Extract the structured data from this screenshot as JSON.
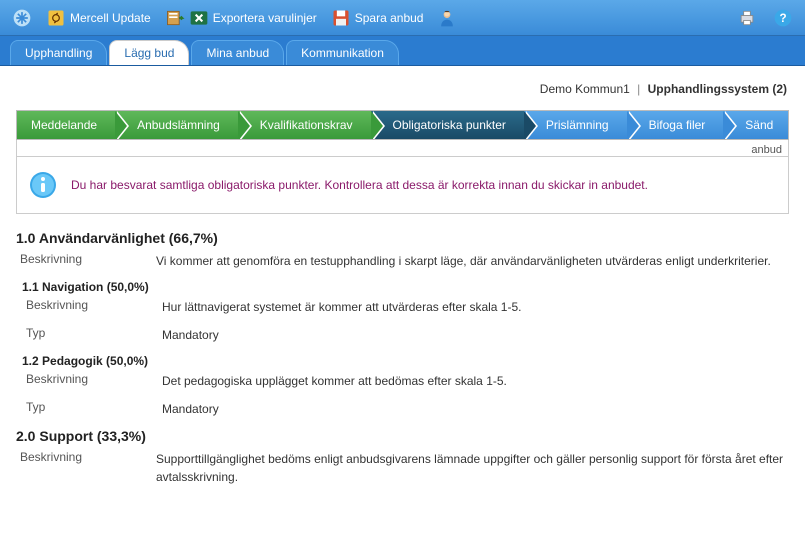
{
  "toolbar": {
    "items": [
      {
        "label": "Mercell Update"
      },
      {
        "label": "Exportera varulinjer"
      },
      {
        "label": "Spara anbud"
      }
    ]
  },
  "tabs": [
    {
      "label": "Upphandling",
      "active": false
    },
    {
      "label": "Lägg bud",
      "active": true
    },
    {
      "label": "Mina anbud",
      "active": false
    },
    {
      "label": "Kommunikation",
      "active": false
    }
  ],
  "context": {
    "org": "Demo Kommun1",
    "system": "Upphandlingssystem (2)"
  },
  "wizard": [
    {
      "label": "Meddelande",
      "state": "green"
    },
    {
      "label": "Anbudslämning",
      "state": "green"
    },
    {
      "label": "Kvalifikationskrav",
      "state": "green"
    },
    {
      "label": "Obligatoriska punkter",
      "state": "dark"
    },
    {
      "label": "Prislämning",
      "state": "blue"
    },
    {
      "label": "Bifoga filer",
      "state": "blue"
    },
    {
      "label": "Sänd",
      "state": "blue"
    }
  ],
  "hanging": "anbud",
  "info": {
    "text": "Du har besvarat samtliga obligatoriska punkter. Kontrollera att dessa är korrekta innan du skickar in anbudet."
  },
  "labels": {
    "beskrivning": "Beskrivning",
    "typ": "Typ"
  },
  "sections": [
    {
      "title": "1.0 Användarvänlighet (66,7%)",
      "beskrivning": "Vi kommer att genomföra en testupphandling i skarpt läge, där användarvänligheten utvärderas enligt underkriterier.",
      "subs": [
        {
          "title": "1.1 Navigation (50,0%)",
          "beskrivning": "Hur lättnavigerat systemet är kommer att utvärderas efter skala 1-5.",
          "typ": "Mandatory"
        },
        {
          "title": "1.2 Pedagogik (50,0%)",
          "beskrivning": "Det pedagogiska upplägget kommer att bedömas efter skala 1-5.",
          "typ": "Mandatory"
        }
      ]
    },
    {
      "title": "2.0 Support (33,3%)",
      "beskrivning": "Supporttillgänglighet bedöms enligt anbudsgivarens lämnade uppgifter och gäller personlig support för första året efter avtalsskrivning.",
      "subs": []
    }
  ]
}
